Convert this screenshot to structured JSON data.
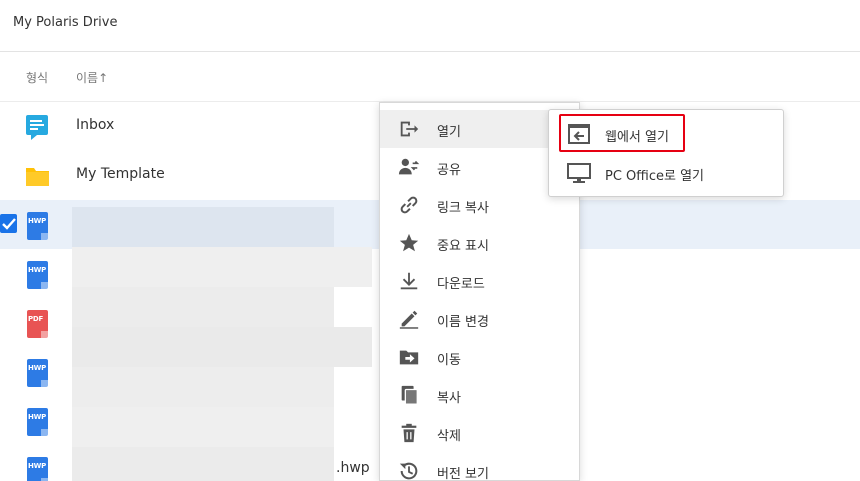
{
  "header": {
    "title": "My Polaris Drive"
  },
  "columns": {
    "type": "형식",
    "name": "이름↑"
  },
  "files": [
    {
      "name": "Inbox",
      "type": "inbox"
    },
    {
      "name": "My Template",
      "type": "folder"
    },
    {
      "name": "",
      "type": "HWP",
      "selected": true
    },
    {
      "name": "",
      "type": "HWP"
    },
    {
      "name": "",
      "type": "PDF"
    },
    {
      "name": "",
      "type": "HWP"
    },
    {
      "name": "",
      "type": "HWP"
    },
    {
      "name": ".hwp",
      "type": "HWP"
    }
  ],
  "context_menu": {
    "items": [
      {
        "label": "열기",
        "icon": "open-icon"
      },
      {
        "label": "공유",
        "icon": "share-icon"
      },
      {
        "label": "링크 복사",
        "icon": "link-icon"
      },
      {
        "label": "중요 표시",
        "icon": "star-icon"
      },
      {
        "label": "다운로드",
        "icon": "download-icon"
      },
      {
        "label": "이름 변경",
        "icon": "rename-icon"
      },
      {
        "label": "이동",
        "icon": "move-icon"
      },
      {
        "label": "복사",
        "icon": "copy-icon"
      },
      {
        "label": "삭제",
        "icon": "trash-icon"
      },
      {
        "label": "버전 보기",
        "icon": "history-icon"
      }
    ]
  },
  "submenu": {
    "items": [
      {
        "label": "웹에서 열기",
        "icon": "web-open-icon"
      },
      {
        "label": "PC Office로 열기",
        "icon": "monitor-icon"
      }
    ]
  },
  "colors": {
    "accent": "#1a73e8",
    "highlight": "#e60012",
    "hwp": "#2d7be5",
    "pdf": "#e85454",
    "folder": "#ffc107",
    "inbox": "#26a9e0"
  }
}
